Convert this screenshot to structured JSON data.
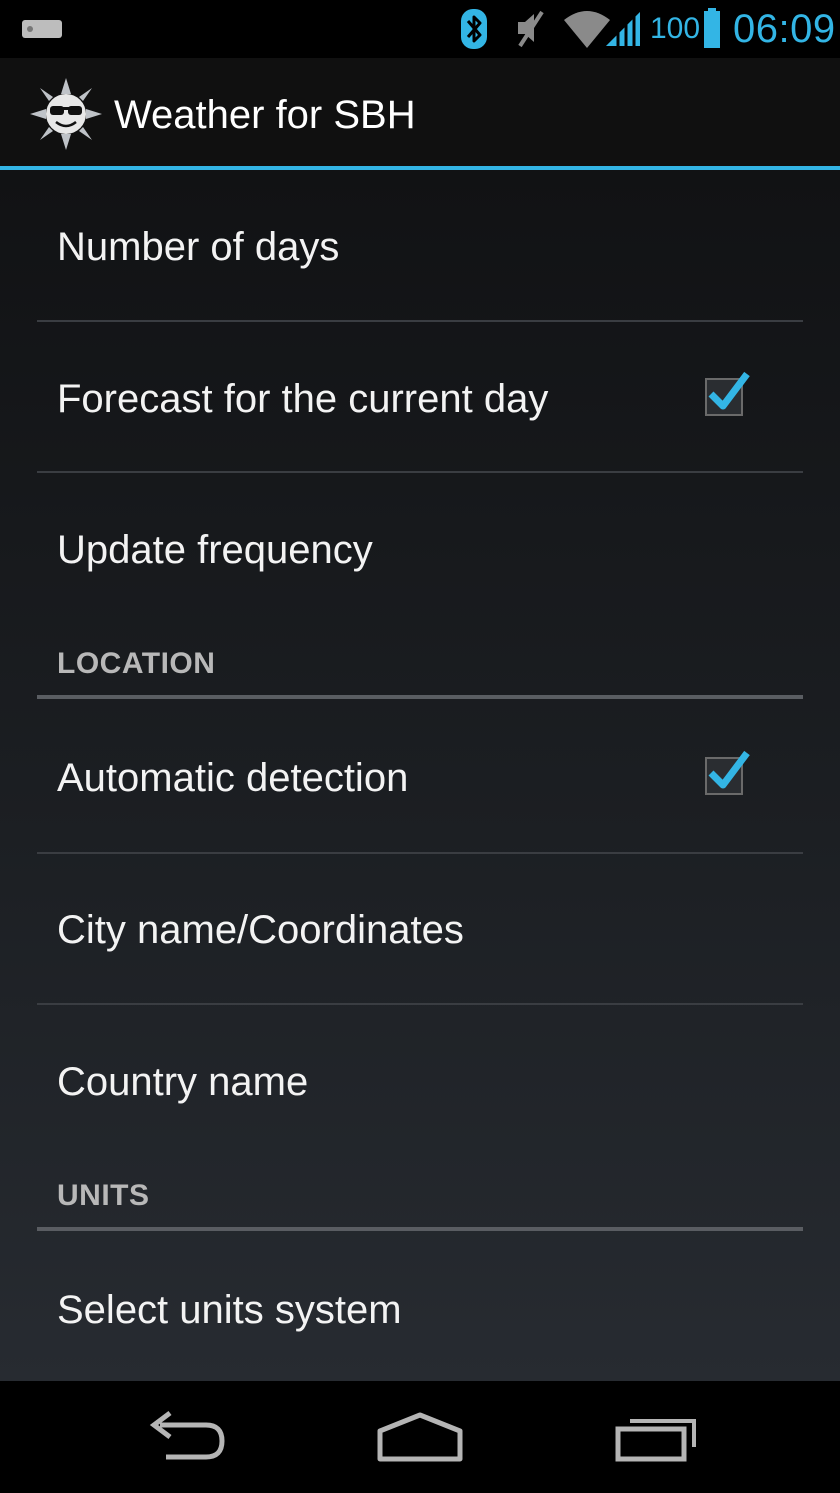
{
  "status_bar": {
    "battery_level": "100",
    "clock": "06:09",
    "icons": [
      "notification-icon",
      "bluetooth-icon",
      "mute-icon",
      "wifi-icon",
      "signal-icon",
      "battery-icon"
    ],
    "accent_color": "#33b5e5"
  },
  "action_bar": {
    "app_icon": "sun-with-sunglasses-icon",
    "title": "Weather for SBH",
    "accent_color": "#33b5e5"
  },
  "preferences": {
    "number_of_days": "Number of days",
    "forecast_current_day": {
      "label": "Forecast for the current day",
      "checked": true
    },
    "update_frequency": "Update frequency",
    "location_category": "LOCATION",
    "automatic_detection": {
      "label": "Automatic detection",
      "checked": true
    },
    "city_name": "City name/Coordinates",
    "country_name": "Country name",
    "units_category": "UNITS",
    "select_units": "Select units system"
  },
  "nav_bar": {
    "buttons": [
      "back-icon",
      "home-icon",
      "recent-apps-icon"
    ]
  }
}
